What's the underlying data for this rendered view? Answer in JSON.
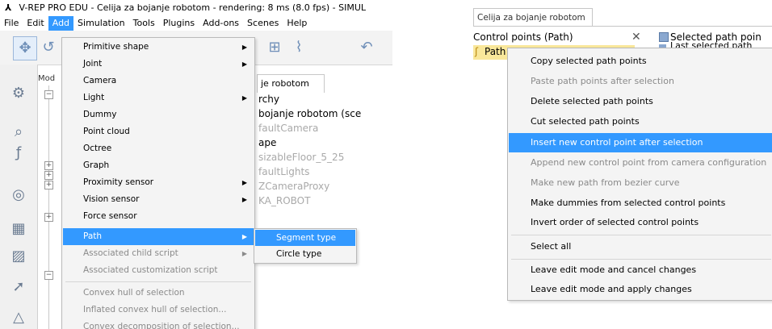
{
  "left": {
    "title": "V-REP PRO EDU - Celija za bojanje robotom - rendering: 8 ms (8.0 fps) - SIMUL",
    "menubar": [
      "File",
      "Edit",
      "Add",
      "Simulation",
      "Tools",
      "Plugins",
      "Add-ons",
      "Scenes",
      "Help"
    ],
    "active_menu": "Add",
    "hierarchy_header": "Mod",
    "scene_tab": "je robotom",
    "scene_tree": [
      {
        "text": "rchy",
        "dim": false
      },
      {
        "text": "bojanje robotom (sce",
        "dim": false
      },
      {
        "text": "faultCamera",
        "dim": true
      },
      {
        "text": "ape",
        "dim": false
      },
      {
        "text": "sizableFloor_5_25",
        "dim": true
      },
      {
        "text": "faultLights",
        "dim": true
      },
      {
        "text": "ZCameraProxy",
        "dim": true
      },
      {
        "text": "KA_ROBOT",
        "dim": true
      }
    ],
    "add_menu": [
      {
        "label": "Primitive shape",
        "sub": true,
        "enabled": true
      },
      {
        "label": "Joint",
        "sub": true,
        "enabled": true
      },
      {
        "label": "Camera",
        "sub": false,
        "enabled": true
      },
      {
        "label": "Light",
        "sub": true,
        "enabled": true
      },
      {
        "label": "Dummy",
        "sub": false,
        "enabled": true
      },
      {
        "label": "Point cloud",
        "sub": false,
        "enabled": true
      },
      {
        "label": "Octree",
        "sub": false,
        "enabled": true
      },
      {
        "label": "Graph",
        "sub": false,
        "enabled": true
      },
      {
        "label": "Proximity sensor",
        "sub": true,
        "enabled": true
      },
      {
        "label": "Vision sensor",
        "sub": true,
        "enabled": true
      },
      {
        "label": "Force sensor",
        "sub": false,
        "enabled": true
      },
      {
        "label": "Path",
        "sub": true,
        "enabled": true,
        "highlight": true
      },
      {
        "label": "Associated child script",
        "sub": true,
        "enabled": false
      },
      {
        "label": "Associated customization script",
        "sub": false,
        "enabled": false
      },
      {
        "label": "Convex hull of selection",
        "sub": false,
        "enabled": false,
        "sep_before": true
      },
      {
        "label": "Inflated convex hull of selection...",
        "sub": false,
        "enabled": false
      },
      {
        "label": "Convex decomposition of selection...",
        "sub": false,
        "enabled": false
      }
    ],
    "path_submenu": [
      {
        "label": "Segment type",
        "highlight": true
      },
      {
        "label": "Circle type",
        "highlight": false
      }
    ]
  },
  "right": {
    "tab": "Celija za bojanje robotom",
    "control_points": "Control points (Path)",
    "close_glyph": "✕",
    "selected_label": "Selected path poin",
    "last_label": "Last selected path",
    "path_item": "Path",
    "context_menu": [
      {
        "label": "Copy selected path points",
        "enabled": true
      },
      {
        "label": "Paste path points after selection",
        "enabled": false
      },
      {
        "label": "Delete selected path points",
        "enabled": true
      },
      {
        "label": "Cut selected path points",
        "enabled": true
      },
      {
        "label": "Insert new control point after selection",
        "enabled": true,
        "highlight": true
      },
      {
        "label": "Append new control point from camera configuration",
        "enabled": false
      },
      {
        "label": "Make new path from bezier curve",
        "enabled": false
      },
      {
        "label": "Make dummies from selected control points",
        "enabled": true
      },
      {
        "label": "Invert order of selected control points",
        "enabled": true
      },
      {
        "label": "Select all",
        "enabled": true,
        "sep_before": true
      },
      {
        "label": "Leave edit mode and cancel changes",
        "enabled": true,
        "sep_before": true
      },
      {
        "label": "Leave edit mode and apply changes",
        "enabled": true
      }
    ]
  },
  "colors": {
    "highlight": "#3399ff",
    "menu_bg": "#f4f4f4",
    "selection_row": "#f9e79a"
  },
  "icons": {
    "toolbar": [
      "move-icon",
      "rotate-icon",
      "shape-edit-icon",
      "path-edit-icon",
      "undo-icon"
    ],
    "vertical": [
      "sim-settings-icon",
      "zoom-icon",
      "function-icon",
      "collection-icon",
      "page-icon",
      "selection-icon",
      "pointer-icon",
      "shape-icon"
    ]
  }
}
